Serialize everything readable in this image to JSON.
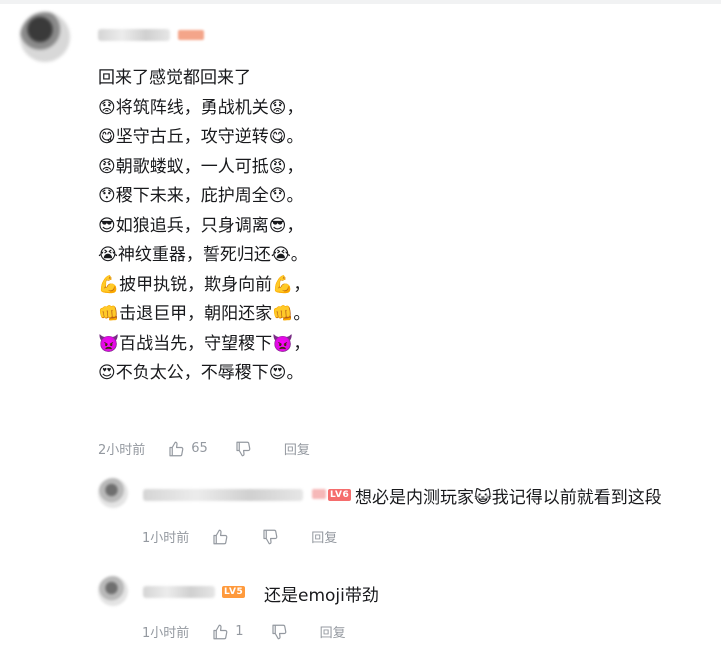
{
  "main_comment": {
    "lines": [
      "回来了感觉都回来了",
      "😟将筑阵线，勇战机关😟，",
      "😋坚守古丘，攻守逆转😋。",
      "😡朝歌蝼蚁，一人可抵😡，",
      "😯稷下未来，庇护周全😯。",
      "😎如狼追兵，只身调离😎，",
      "😭神纹重器，誓死归还😭。",
      "💪披甲执锐，欺身向前💪，",
      "👊击退巨甲，朝阳还家👊。",
      "👿百战当先，守望稷下👿，",
      "😍不负太公，不辱稷下😍。"
    ],
    "time": "2小时前",
    "likes": "65",
    "reply_label": "回复"
  },
  "replies": [
    {
      "level_badge": "LV6",
      "text": "想必是内测玩家😺我记得以前就看到这段",
      "time": "1小时前",
      "likes": "",
      "reply_label": "回复",
      "badge_color": "#f56d6d"
    },
    {
      "level_badge": "LV5",
      "text": "还是emoji带劲",
      "time": "1小时前",
      "likes": "1",
      "reply_label": "回复",
      "badge_color": "#ff9a3c"
    }
  ],
  "icons": {
    "like": "thumbs-up-icon",
    "dislike": "thumbs-down-icon"
  },
  "colors": {
    "text": "#18191c",
    "meta": "#9499a0"
  }
}
